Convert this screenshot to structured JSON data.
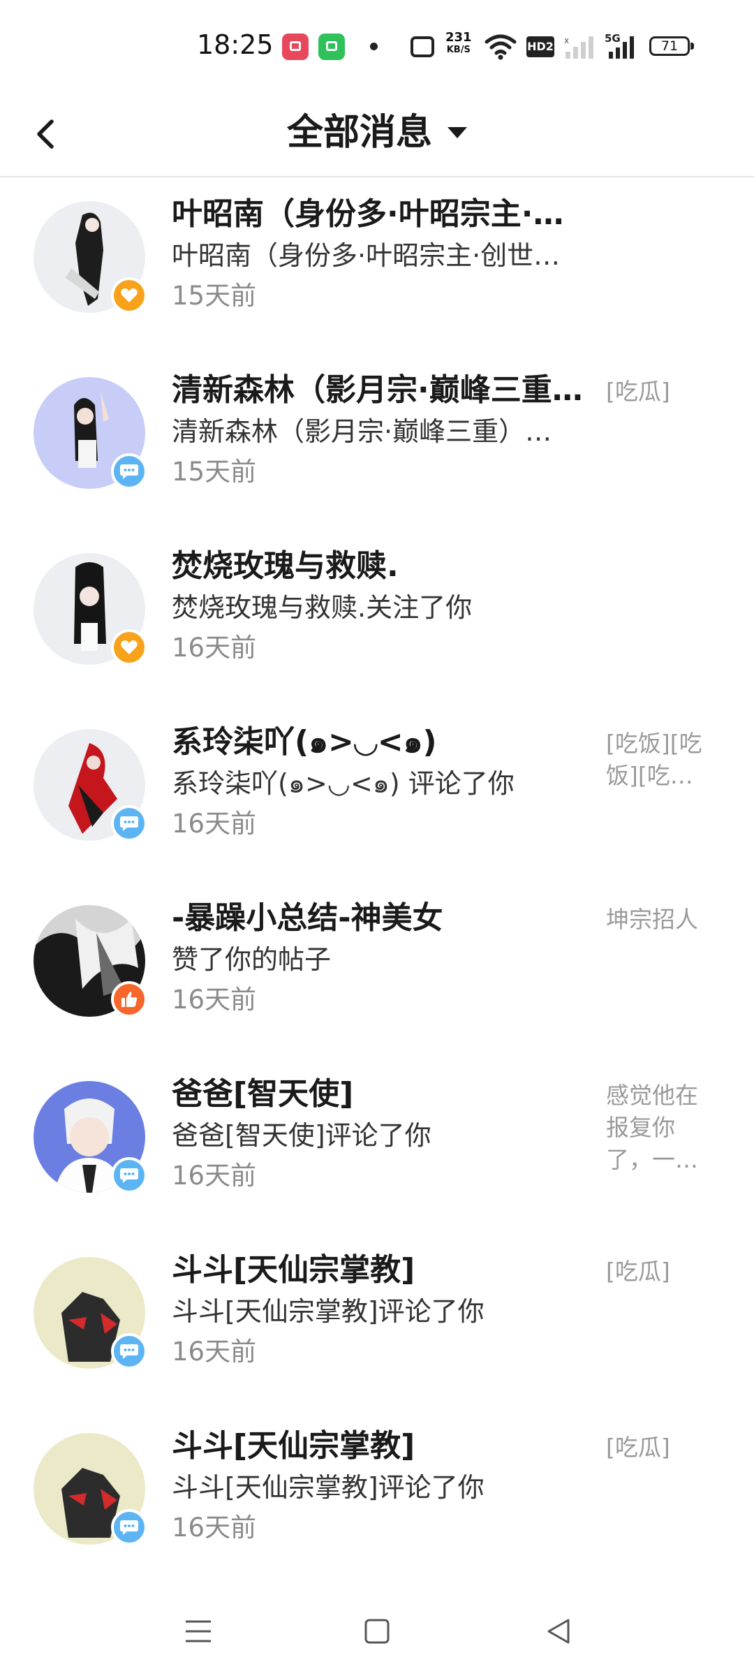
{
  "status_bar": {
    "time": "18:25",
    "net_speed_value": "231",
    "net_speed_unit": "KB/S",
    "hd_label": "HD2",
    "network_label": "5G",
    "battery": "71",
    "icons": [
      "screen-recorder-icon",
      "app-store-icon",
      "dot-icon",
      "nfc-icon",
      "wifi-icon",
      "hd-icon",
      "signal-icon",
      "signal-5g-icon",
      "battery-icon"
    ]
  },
  "header": {
    "back_icon": "chevron-left-icon",
    "title": "全部消息",
    "dropdown_icon": "caret-down-icon"
  },
  "colors": {
    "heart_badge": "#f7a21a",
    "chat_badge": "#5cb4f2",
    "like_badge": "#f7662a"
  },
  "messages": [
    {
      "name": "叶昭南（身份多·叶昭宗主·创世…",
      "content": "叶昭南（身份多·叶昭宗主·创世…",
      "time": "15天前",
      "preview": "",
      "badge": "heart-icon"
    },
    {
      "name": "清新森林（影月宗·巅峰三重）…",
      "content": "清新森林（影月宗·巅峰三重）…",
      "time": "15天前",
      "preview": "[吃瓜]",
      "badge": "chat-icon"
    },
    {
      "name": "焚烧玫瑰与救赎.",
      "content": "焚烧玫瑰与救赎.关注了你",
      "time": "16天前",
      "preview": "",
      "badge": "heart-icon"
    },
    {
      "name": "系玲柒吖(๑>◡<๑)",
      "content": "系玲柒吖(๑>◡<๑) 评论了你",
      "time": "16天前",
      "preview": "[吃饭][吃饭][吃…",
      "badge": "chat-icon"
    },
    {
      "name": "-暴躁小总结-神美女",
      "content": "赞了你的帖子",
      "time": "16天前",
      "preview": "坤宗招人",
      "badge": "thumbs-up-icon"
    },
    {
      "name": "爸爸[智天使]",
      "content": "爸爸[智天使]评论了你",
      "time": "16天前",
      "preview": "感觉他在报复你了，一…",
      "badge": "chat-icon"
    },
    {
      "name": "斗斗[天仙宗掌教]",
      "content": "斗斗[天仙宗掌教]评论了你",
      "time": "16天前",
      "preview": "[吃瓜]",
      "badge": "chat-icon"
    },
    {
      "name": "斗斗[天仙宗掌教]",
      "content": "斗斗[天仙宗掌教]评论了你",
      "time": "16天前",
      "preview": "[吃瓜]",
      "badge": "chat-icon"
    }
  ],
  "nav_bar": {
    "icons": [
      "menu-icon",
      "home-square-icon",
      "back-triangle-icon"
    ]
  }
}
